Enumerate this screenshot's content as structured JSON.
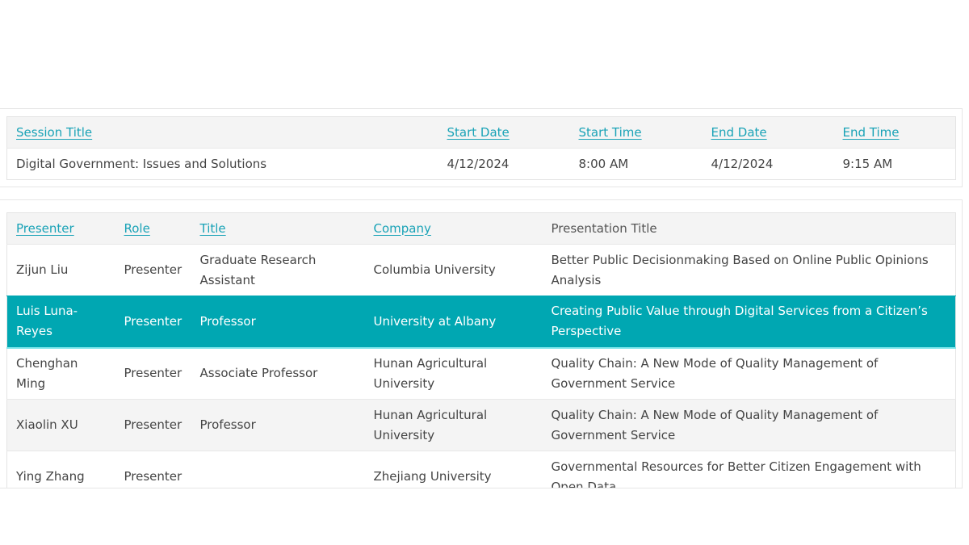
{
  "session_table": {
    "headers": [
      {
        "label": "Session Title",
        "sortable": true
      },
      {
        "label": "Start Date",
        "sortable": true
      },
      {
        "label": "Start Time",
        "sortable": true
      },
      {
        "label": "End Date",
        "sortable": true
      },
      {
        "label": "End Time",
        "sortable": true
      }
    ],
    "rows": [
      {
        "session_title": "Digital Government: Issues and Solutions",
        "start_date": "4/12/2024",
        "start_time": "8:00 AM",
        "end_date": "4/12/2024",
        "end_time": "9:15 AM"
      }
    ]
  },
  "presenter_table": {
    "headers": [
      {
        "label": "Presenter",
        "sortable": true
      },
      {
        "label": "Role",
        "sortable": true
      },
      {
        "label": "Title",
        "sortable": true
      },
      {
        "label": "Company",
        "sortable": true
      },
      {
        "label": "Presentation Title",
        "sortable": false
      }
    ],
    "selected_row": 1,
    "rows": [
      {
        "presenter": "Zijun Liu",
        "role": "Presenter",
        "title": "Graduate Research Assistant",
        "company": "Columbia University",
        "presentation_title": "Better Public Decisionmaking Based on Online Public Opinions Analysis"
      },
      {
        "presenter": "Luis Luna-Reyes",
        "role": "Presenter",
        "title": "Professor",
        "company": "University at Albany",
        "presentation_title": "Creating Public Value through Digital Services from a Citizen’s Perspective"
      },
      {
        "presenter": "Chenghan Ming",
        "role": "Presenter",
        "title": "Associate Professor",
        "company": "Hunan Agricultural University",
        "presentation_title": "Quality Chain: A New Mode of Quality Management of Government Service"
      },
      {
        "presenter": "Xiaolin XU",
        "role": "Presenter",
        "title": "Professor",
        "company": "Hunan Agricultural University",
        "presentation_title": "Quality Chain: A New Mode of Quality Management of Government Service"
      },
      {
        "presenter": "Ying Zhang",
        "role": "Presenter",
        "title": "",
        "company": "Zhejiang University",
        "presentation_title": "Governmental Resources for Better Citizen Engagement with Open Data"
      }
    ]
  },
  "colors": {
    "link": "#1aa3b7",
    "selected_row_bg": "#00a7b2",
    "header_bg": "#f4f4f4",
    "alt_row_bg": "#f4f4f4",
    "text": "#444444"
  }
}
